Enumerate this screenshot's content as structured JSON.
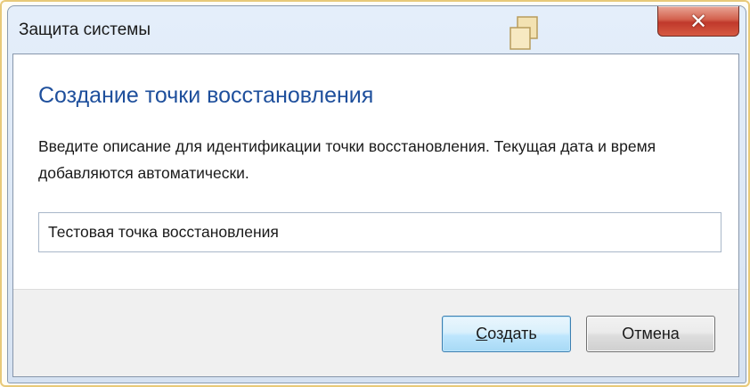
{
  "window": {
    "title": "Защита системы",
    "close_symbol": "✕",
    "icons": {
      "restore": "restore-icon",
      "close": "close-icon"
    }
  },
  "dialog": {
    "heading": "Создание точки восстановления",
    "description": "Введите описание для идентификации точки восстановления. Текущая дата и время добавляются автоматически.",
    "input": {
      "value": "Тестовая точка восстановления"
    },
    "buttons": {
      "create": "Создать",
      "cancel": "Отмена"
    }
  },
  "colors": {
    "heading": "#1e4f9c",
    "close_button": "#c0392b",
    "default_button": "#bee6fd"
  }
}
